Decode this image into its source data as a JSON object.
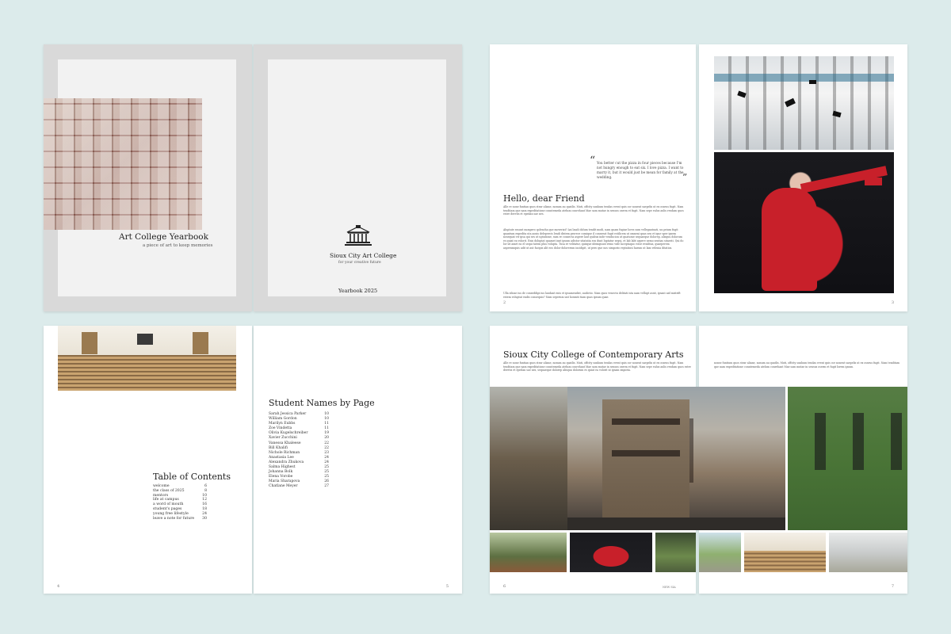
{
  "spread1": {
    "cover_title": "Art College Yearbook",
    "cover_subtitle": "a piece of art to keep memories",
    "college_name": "Sioux City Art College",
    "college_tagline": "for your creative future",
    "year_label": "Yearbook 2025"
  },
  "spread2": {
    "quote": "You better cut the pizza in four pieces because I'm not hungry enough to eat six. I love pizza. I want to marry it, but it would just be mean for family at the wedding.",
    "heading": "Hello, dear Friend",
    "page_left": "2",
    "page_right": "3"
  },
  "spread3": {
    "toc_title": "Table of Contents",
    "toc": [
      {
        "label": "welcome",
        "page": "6"
      },
      {
        "label": "the class of 2025",
        "page": "8"
      },
      {
        "label": "mentors",
        "page": "10"
      },
      {
        "label": "life at campus",
        "page": "12"
      },
      {
        "label": "a word of mouth",
        "page": "16"
      },
      {
        "label": "student's pages",
        "page": "18"
      },
      {
        "label": "young free lifestyle",
        "page": "24"
      },
      {
        "label": "leave a note for future",
        "page": "30"
      }
    ],
    "names_title": "Student Names by Page",
    "names": [
      {
        "label": "Sarah Jessica Parker",
        "page": "10"
      },
      {
        "label": "William Gordon",
        "page": "10"
      },
      {
        "label": "Marilyn Eubbs",
        "page": "11"
      },
      {
        "label": "Zoe Vindetta",
        "page": "11"
      },
      {
        "label": "Olivia Kugelschreiber",
        "page": "19"
      },
      {
        "label": "Xavier Zucchini",
        "page": "20"
      },
      {
        "label": "Vanessa Khaleese",
        "page": "22"
      },
      {
        "label": "Bill Khalifi",
        "page": "22"
      },
      {
        "label": "Nichole Richman",
        "page": "23"
      },
      {
        "label": "Anastasia Lee",
        "page": "24"
      },
      {
        "label": "Alexandra Zhukova",
        "page": "24"
      },
      {
        "label": "Salma Highest",
        "page": "25"
      },
      {
        "label": "Johanna Bolk",
        "page": "25"
      },
      {
        "label": "Elena Vorobe",
        "page": "25"
      },
      {
        "label": "Maria Sharapova",
        "page": "26"
      },
      {
        "label": "Chatlane Meyer",
        "page": "27"
      }
    ],
    "page_left": "4",
    "page_right": "5"
  },
  "spread4": {
    "heading": "Sioux City College of Contemporary Arts",
    "page_left": "6",
    "page_center": "NEW SIA",
    "page_right": "7"
  },
  "colors": {
    "background": "#dcebeb",
    "grey_frame": "#d9d9d9",
    "graduate_red": "#c8202a"
  }
}
